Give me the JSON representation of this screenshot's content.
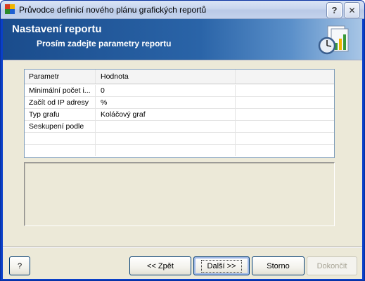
{
  "window": {
    "title": "Průvodce definicí nového plánu grafických reportů",
    "help_glyph": "?",
    "close_glyph": "✕"
  },
  "banner": {
    "title": "Nastavení reportu",
    "subtitle": "Prosím zadejte parametry reportu",
    "icon": "report-clock-chart-icon"
  },
  "grid": {
    "columns": [
      "Parametr",
      "Hodnota"
    ],
    "rows": [
      {
        "param": "Minimální počet i...",
        "value": "0"
      },
      {
        "param": "Začít od IP adresy",
        "value": "%"
      },
      {
        "param": "Typ grafu",
        "value": "Koláčový graf"
      },
      {
        "param": "Seskupení podle",
        "value": ""
      },
      {
        "param": "",
        "value": ""
      },
      {
        "param": "",
        "value": ""
      }
    ]
  },
  "buttons": {
    "help": "?",
    "back": "<< Zpět",
    "next": "Další >>",
    "cancel": "Storno",
    "finish": "Dokončit"
  },
  "colors": {
    "banner_dark": "#1a4c8c",
    "banner_light": "#a8c6e6",
    "dialog_bg": "#ece9d8"
  }
}
